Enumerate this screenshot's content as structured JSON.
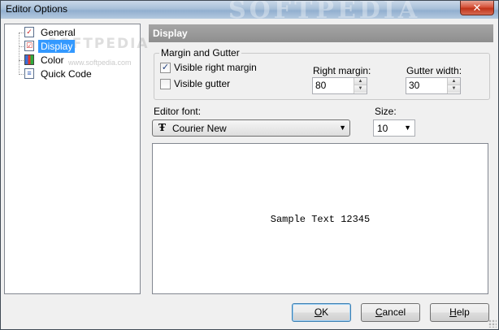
{
  "window": {
    "title": "Editor Options",
    "watermark": "SOFTPEDIA",
    "close_glyph": "✕"
  },
  "tree": {
    "watermark": "SOFTPEDIA",
    "watermark_url": "www.softpedia.com",
    "items": [
      {
        "label": "General",
        "icon": "checklist-icon"
      },
      {
        "label": "Display",
        "icon": "display-checklist-icon",
        "selected": true
      },
      {
        "label": "Color",
        "icon": "color-palette-icon"
      },
      {
        "label": "Quick Code",
        "icon": "code-document-icon"
      }
    ]
  },
  "panel": {
    "header": "Display",
    "margin_group": {
      "title": "Margin and Gutter",
      "visible_right_margin": {
        "label": "Visible right margin",
        "checked": true
      },
      "visible_gutter": {
        "label": "Visible gutter",
        "checked": false
      },
      "right_margin": {
        "label": "Right margin:",
        "value": "80"
      },
      "gutter_width": {
        "label": "Gutter width:",
        "value": "30"
      }
    },
    "editor_font": {
      "label": "Editor font:",
      "value": "Courier New",
      "icon_glyph": "Ŧ"
    },
    "size": {
      "label": "Size:",
      "value": "10"
    },
    "preview": {
      "text": "Sample Text 12345"
    }
  },
  "buttons": {
    "ok": {
      "mnemonic": "O",
      "rest": "K"
    },
    "cancel": {
      "mnemonic": "C",
      "rest": "ancel"
    },
    "help": {
      "mnemonic": "H",
      "rest": "elp"
    }
  },
  "colors": {
    "selection": "#3399ff",
    "header_bg": "#999999"
  }
}
